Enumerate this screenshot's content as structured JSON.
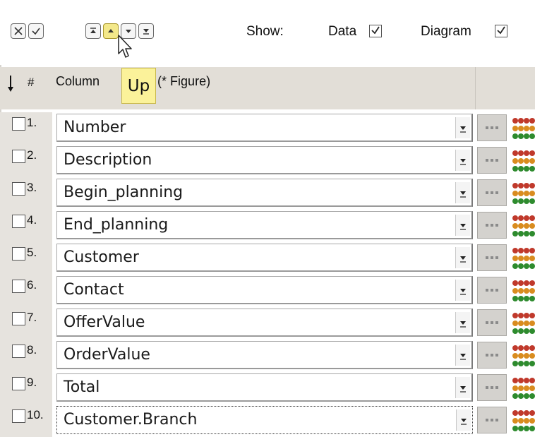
{
  "toolbar": {
    "show_label": "Show:",
    "data_label": "Data",
    "data_checked": true,
    "diagram_label": "Diagram",
    "diagram_checked": true,
    "buttons": [
      "close-icon",
      "check-icon",
      "move-top-icon",
      "move-up-icon",
      "move-down-icon",
      "move-bottom-icon"
    ]
  },
  "header": {
    "sort_icon": "down-arrow-icon",
    "number_label": "#",
    "column_label_left": "Column",
    "column_label_right": "ent (* Figure)"
  },
  "tooltip": {
    "text": "Up"
  },
  "rows": [
    {
      "num": "1.",
      "value": "Number",
      "checked": false
    },
    {
      "num": "2.",
      "value": "Description",
      "checked": false
    },
    {
      "num": "3.",
      "value": "Begin_planning",
      "checked": false
    },
    {
      "num": "4.",
      "value": "End_planning",
      "checked": false
    },
    {
      "num": "5.",
      "value": "Customer",
      "checked": false
    },
    {
      "num": "6.",
      "value": "Contact",
      "checked": false
    },
    {
      "num": "7.",
      "value": "OfferValue",
      "checked": false
    },
    {
      "num": "8.",
      "value": "OrderValue",
      "checked": false
    },
    {
      "num": "9.",
      "value": "Total",
      "checked": false
    },
    {
      "num": "10.",
      "value": "Customer.Branch",
      "checked": false
    }
  ],
  "colors": {
    "header_bg": "#e2ded7",
    "tooltip_bg": "#fbf29a",
    "palette_red": "#c0392b",
    "palette_orange": "#d98c1f",
    "palette_green": "#2e8b2e"
  }
}
